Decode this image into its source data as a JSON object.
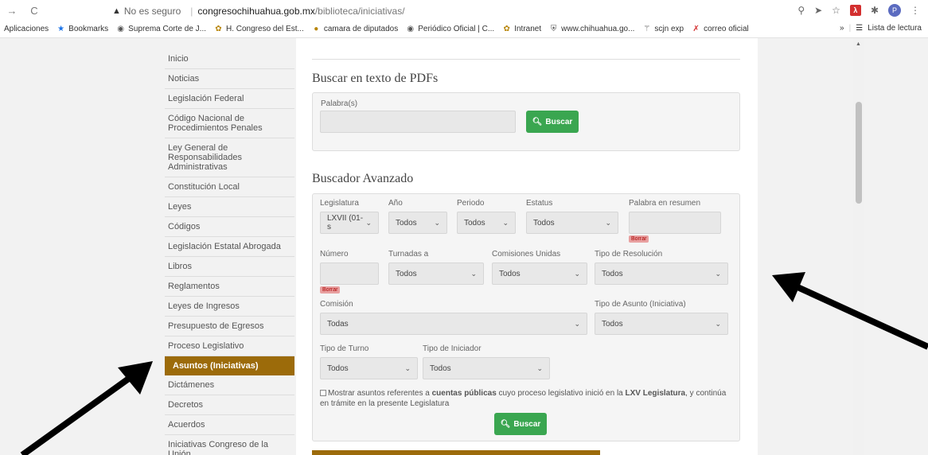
{
  "browser": {
    "insecure_label": "No es seguro",
    "url_host": "congresochihuahua.gob.mx",
    "url_path": "/biblioteca/iniciativas/",
    "profile_initial": "P",
    "bookmarks": [
      {
        "label": "Aplicaciones",
        "icon": "apps-grid-icon"
      },
      {
        "label": "Bookmarks",
        "icon": "star-icon"
      },
      {
        "label": "Suprema Corte de J...",
        "icon": "globe-icon"
      },
      {
        "label": "H. Congreso del Est...",
        "icon": "seal-icon"
      },
      {
        "label": "camara de diputados",
        "icon": "camara-icon"
      },
      {
        "label": "Periódico Oficial | C...",
        "icon": "globe-icon"
      },
      {
        "label": "Intranet",
        "icon": "seal-icon"
      },
      {
        "label": "www.chihuahua.go...",
        "icon": "shield-icon"
      },
      {
        "label": "scjn exp",
        "icon": "eagle-icon"
      },
      {
        "label": "correo oficial",
        "icon": "x-icon"
      }
    ],
    "overflow_label": "»",
    "reading_list_label": "Lista de lectura"
  },
  "sidebar": {
    "items": [
      {
        "label": "Inicio",
        "active": false
      },
      {
        "label": "Noticias",
        "active": false
      },
      {
        "label": "Legislación Federal",
        "active": false
      },
      {
        "label": "Código Nacional de Procedimientos Penales",
        "active": false
      },
      {
        "label": "Ley General de Responsabilidades Administrativas",
        "active": false
      },
      {
        "label": "Constitución Local",
        "active": false
      },
      {
        "label": "Leyes",
        "active": false
      },
      {
        "label": "Códigos",
        "active": false
      },
      {
        "label": "Legislación Estatal Abrogada",
        "active": false
      },
      {
        "label": "Libros",
        "active": false
      },
      {
        "label": "Reglamentos",
        "active": false
      },
      {
        "label": "Leyes de Ingresos",
        "active": false
      },
      {
        "label": "Presupuesto de Egresos",
        "active": false
      },
      {
        "label": "Proceso Legislativo",
        "active": false
      },
      {
        "label": "Asuntos (Iniciativas)",
        "active": true
      },
      {
        "label": "Dictámenes",
        "active": false
      },
      {
        "label": "Decretos",
        "active": false
      },
      {
        "label": "Acuerdos",
        "active": false
      },
      {
        "label": "Iniciativas Congreso de la Unión",
        "active": false
      }
    ]
  },
  "pdf_search": {
    "title": "Buscar en texto de PDFs",
    "word_label": "Palabra(s)",
    "word_value": "",
    "button_label": "Buscar"
  },
  "advanced": {
    "title": "Buscador Avanzado",
    "legislatura_label": "Legislatura",
    "legislatura_value": "LXVII (01-s",
    "anio_label": "Año",
    "anio_value": "Todos",
    "periodo_label": "Periodo",
    "periodo_value": "Todos",
    "estatus_label": "Estatus",
    "estatus_value": "Todos",
    "palabra_label": "Palabra en resumen",
    "borrar_label": "Borrar",
    "numero_label": "Número",
    "turnadas_label": "Turnadas a",
    "turnadas_value": "Todos",
    "comisiones_label": "Comisiones Unidas",
    "comisiones_value": "Todos",
    "resolucion_label": "Tipo de Resolución",
    "resolucion_value": "Todos",
    "comision_label": "Comisión",
    "comision_value": "Todas",
    "asunto_label": "Tipo de Asunto (Iniciativa)",
    "asunto_value": "Todos",
    "turno_label": "Tipo de Turno",
    "turno_value": "Todos",
    "iniciador_label": "Tipo de Iniciador",
    "iniciador_value": "Todos",
    "checkbox_pre": "Mostrar asuntos referentes a ",
    "checkbox_bold1": "cuentas públicas",
    "checkbox_mid": " cuyo proceso legislativo inició en la ",
    "checkbox_bold2": "LXV Legislatura",
    "checkbox_post": ", y continúa en trámite en la presente Legislatura",
    "button_label": "Buscar"
  },
  "colors": {
    "accent": "#9c6b0a",
    "button_green": "#3aa650",
    "panel_bg": "#f5f5f5"
  }
}
